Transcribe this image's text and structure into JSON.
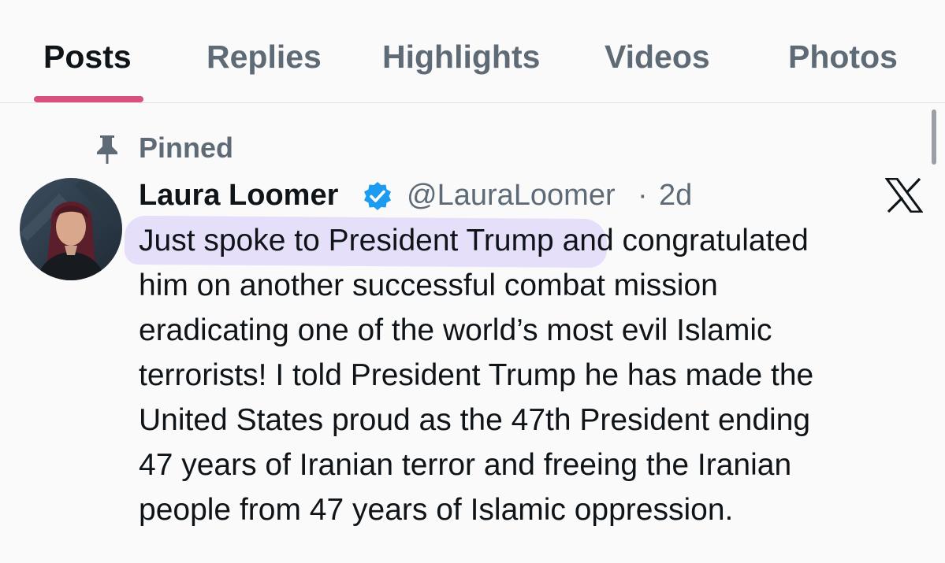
{
  "tabs": [
    {
      "label": "Posts",
      "active": true
    },
    {
      "label": "Replies",
      "active": false
    },
    {
      "label": "Highlights",
      "active": false
    },
    {
      "label": "Videos",
      "active": false
    },
    {
      "label": "Photos",
      "active": false
    }
  ],
  "pinned": {
    "label": "Pinned",
    "icon": "pin-icon"
  },
  "post": {
    "author_name": "Laura Loomer",
    "verified": true,
    "handle": "@LauraLoomer",
    "separator": "·",
    "time": "2d",
    "lines": [
      "Just spoke to President Trump and congratulated",
      "him on another successful combat mission",
      "eradicating one of the world’s most evil Islamic",
      "terrorists! I told President Trump he has made the",
      "United States proud as the 47th President ending",
      "47 years of Iranian terror and freeing the Iranian",
      "people from 47 years of Islamic oppression."
    ],
    "highlighted_text": "Just spoke to President Trump"
  },
  "colors": {
    "active_tab": "#0f1419",
    "inactive_tab": "#5e6a75",
    "indicator": "#d9507f",
    "verified_badge": "#1d9bf0",
    "highlight": "#d6c8fa"
  }
}
